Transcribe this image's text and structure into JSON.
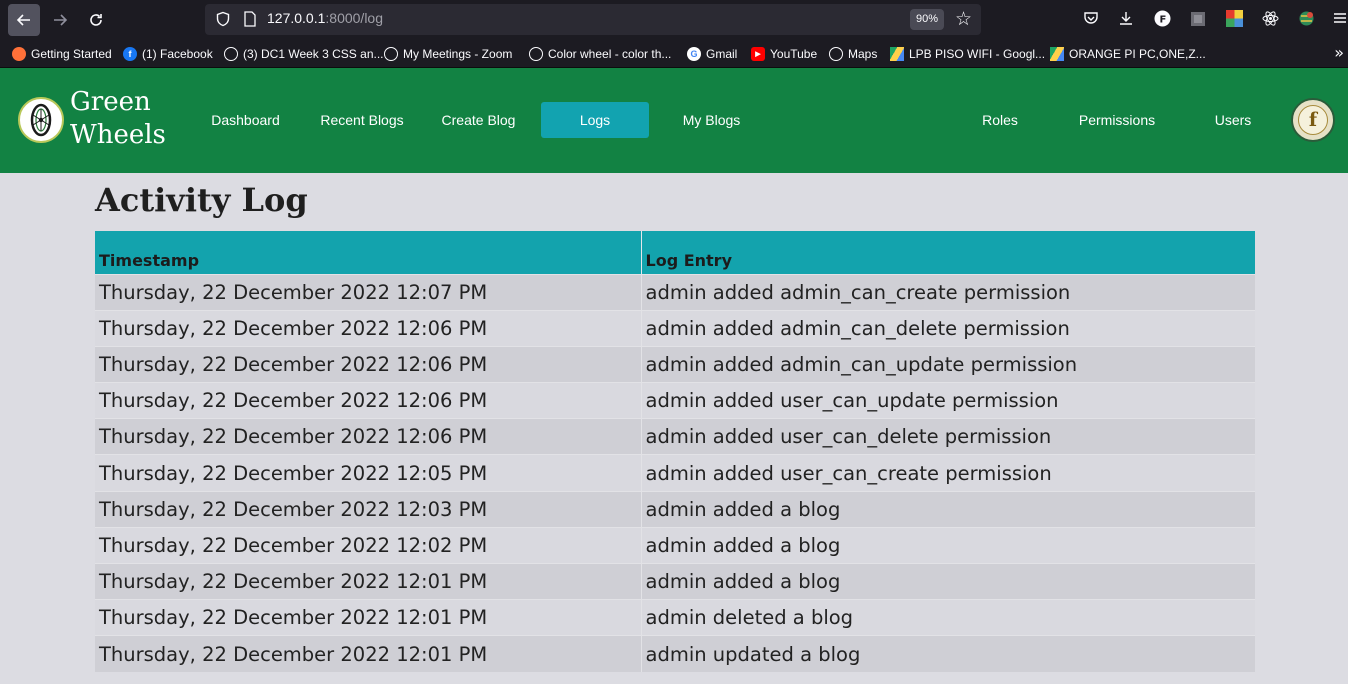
{
  "browser": {
    "url_host": "127.0.0.1",
    "url_rest": ":8000/log",
    "zoom": "90%",
    "toolbar_icons": [
      "pocket-icon",
      "download-icon",
      "profile-icon",
      "extension-icon",
      "color-picker-extension-icon",
      "react-devtools-icon",
      "globe-extension-icon",
      "menu-icon"
    ]
  },
  "bookmarks": [
    {
      "label": "Getting Started",
      "icon": "firefox-icon",
      "color": "#ff7139"
    },
    {
      "label": "(1) Facebook",
      "icon": "facebook-icon",
      "color": "#1877f2"
    },
    {
      "label": "(3) DC1 Week 3 CSS an...",
      "icon": "globe-icon",
      "color": "#1c1b22"
    },
    {
      "label": "My Meetings - Zoom",
      "icon": "globe-icon",
      "color": "#1c1b22"
    },
    {
      "label": "Color wheel - color th...",
      "icon": "globe-icon",
      "color": "#1c1b22"
    },
    {
      "label": "Gmail",
      "icon": "google-icon",
      "color": "#ffffff"
    },
    {
      "label": "YouTube",
      "icon": "youtube-icon",
      "color": "#ff0000"
    },
    {
      "label": "Maps",
      "icon": "globe-icon",
      "color": "#1c1b22"
    },
    {
      "label": "LPB PISO WIFI - Googl...",
      "icon": "drive-icon",
      "color": "#1c1b22"
    },
    {
      "label": "ORANGE PI PC,ONE,Z...",
      "icon": "drive-icon",
      "color": "#1c1b22"
    }
  ],
  "header": {
    "brand_line1": "Green",
    "brand_line2": "Wheels",
    "nav": [
      {
        "label": "Dashboard",
        "active": false
      },
      {
        "label": "Recent Blogs",
        "active": false
      },
      {
        "label": "Create Blog",
        "active": false
      },
      {
        "label": "Logs",
        "active": true
      },
      {
        "label": "My Blogs",
        "active": false
      },
      {
        "label": "Roles",
        "active": false
      },
      {
        "label": "Permissions",
        "active": false
      },
      {
        "label": "Users",
        "active": false
      }
    ],
    "avatar_letter": "f",
    "colors": {
      "header_bg": "#128243",
      "accent": "#13a3ad"
    }
  },
  "main": {
    "title": "Activity Log",
    "columns": [
      "Timestamp",
      "Log Entry"
    ],
    "rows": [
      [
        "Thursday, 22 December 2022 12:07 PM",
        "admin added admin_can_create permission"
      ],
      [
        "Thursday, 22 December 2022 12:06 PM",
        "admin added admin_can_delete permission"
      ],
      [
        "Thursday, 22 December 2022 12:06 PM",
        "admin added admin_can_update permission"
      ],
      [
        "Thursday, 22 December 2022 12:06 PM",
        "admin added user_can_update permission"
      ],
      [
        "Thursday, 22 December 2022 12:06 PM",
        "admin added user_can_delete permission"
      ],
      [
        "Thursday, 22 December 2022 12:05 PM",
        "admin added user_can_create permission"
      ],
      [
        "Thursday, 22 December 2022 12:03 PM",
        "admin added a blog"
      ],
      [
        "Thursday, 22 December 2022 12:02 PM",
        "admin added a blog"
      ],
      [
        "Thursday, 22 December 2022 12:01 PM",
        "admin added a blog"
      ],
      [
        "Thursday, 22 December 2022 12:01 PM",
        "admin deleted a blog"
      ],
      [
        "Thursday, 22 December 2022 12:01 PM",
        "admin updated a blog"
      ]
    ]
  }
}
